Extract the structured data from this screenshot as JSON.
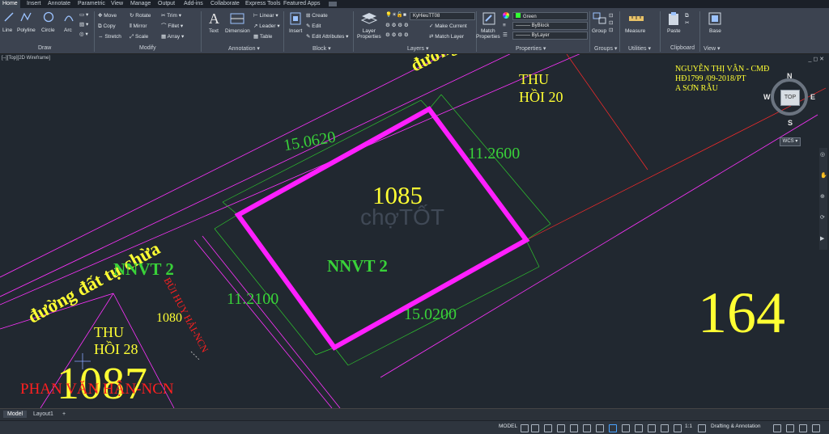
{
  "tabs": [
    "Home",
    "Insert",
    "Annotate",
    "Parametric",
    "View",
    "Manage",
    "Output",
    "Add-ins",
    "Collaborate",
    "Express Tools",
    "Featured Apps"
  ],
  "ribbon": {
    "draw": {
      "title": "Draw",
      "line": "Line",
      "polyline": "Polyline",
      "circle": "Circle",
      "arc": "Arc"
    },
    "modify": {
      "title": "Modify",
      "move": "Move",
      "rotate": "Rotate",
      "trim": "Trim",
      "copy": "Copy",
      "mirror": "Mirror",
      "fillet": "Fillet",
      "stretch": "Stretch",
      "scale": "Scale",
      "array": "Array"
    },
    "annotation": {
      "title": "Annotation",
      "text": "Text",
      "dimension": "Dimension",
      "linear": "Linear",
      "leader": "Leader",
      "table": "Table"
    },
    "block": {
      "title": "Block",
      "insert": "Insert",
      "create": "Create",
      "edit": "Edit",
      "edit_attributes": "Edit Attributes"
    },
    "layers": {
      "title": "Layers",
      "layer_properties_l1": "Layer",
      "layer_properties_l2": "Properties",
      "current_layer": "KyHieuTT08",
      "make_current": "Make Current",
      "match_layer": "Match Layer"
    },
    "properties": {
      "title": "Properties",
      "match_l1": "Match",
      "match_l2": "Properties",
      "color": "Green",
      "linetype": "ByBlock",
      "lineweight": "ByLayer"
    },
    "groups": {
      "title": "Groups",
      "group": "Group"
    },
    "utilities": {
      "title": "Utilities",
      "measure": "Measure"
    },
    "clipboard": {
      "title": "Clipboard",
      "paste": "Paste"
    },
    "view": {
      "title": "View",
      "base": "Base"
    }
  },
  "viewport": {
    "label": "[–][Top][2D Wireframe]"
  },
  "drawing": {
    "parcel_number": "1085",
    "parcel_class": "NNVT 2",
    "side_top": "15.0620",
    "side_right": "11.2600",
    "side_left": "11.2100",
    "side_bottom": "15.0200",
    "road_label": "đường đất tự chừa",
    "road_label_top": "đường",
    "thu_hoi_20_l1": "THU",
    "thu_hoi_20_l2": "HỒI 20",
    "thu_hoi_28_l1": "THU",
    "thu_hoi_28_l2": "HỒI 28",
    "nnvt_left": "NNVT 2",
    "number_1080": "1080",
    "number_1087": "1087",
    "number_164": "164",
    "owner_left": "BÙI HUY HẢI-NCN",
    "owner_bottom": "PHAN VĂN HẬN-NCN",
    "note_l1": "NGUYỄN THỊ VÂN - CMĐ",
    "note_l2": "HĐ1799 /09-2018/PT",
    "note_l3": "A SƠN RẪU",
    "watermark": "chợTỐT"
  },
  "viewcube": {
    "n": "N",
    "s": "S",
    "e": "E",
    "w": "W",
    "top": "TOP",
    "wcs": "WCS"
  },
  "layouts": {
    "model": "Model",
    "layout1": "Layout1",
    "add": "+"
  },
  "status": {
    "model": "MODEL",
    "scale": "1:1",
    "workspace": "Drafting & Annotation"
  },
  "colors": {
    "parcel": "#ff1fff",
    "green_text": "#39d239",
    "yellow_text": "#ffff33",
    "red_text": "#ff2020",
    "boundary": "#ff33ff",
    "dim": "#2ec82e",
    "background": "#212830"
  }
}
